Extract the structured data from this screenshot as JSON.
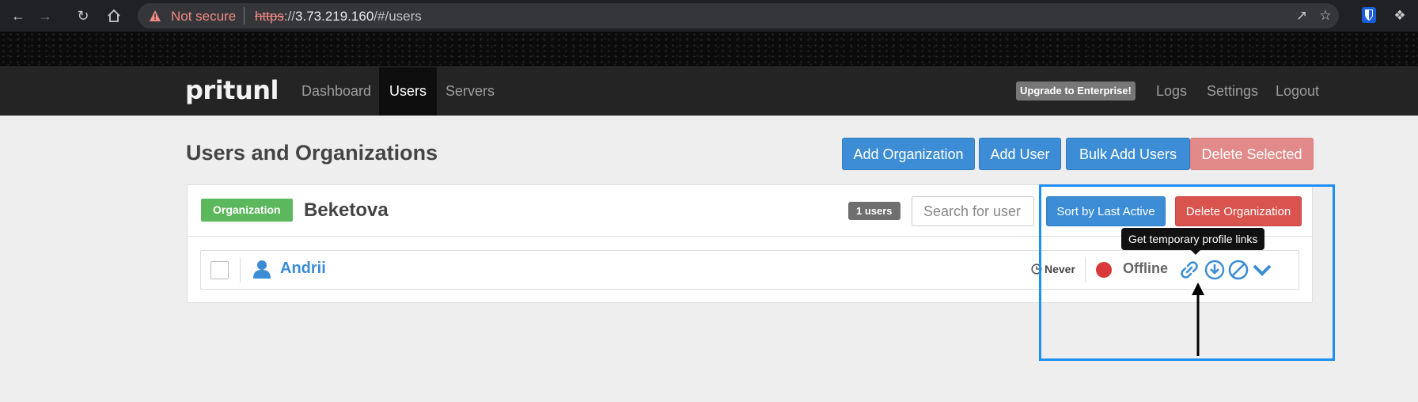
{
  "browser": {
    "not_secure": "Not secure",
    "url_proto": "https",
    "url_host": "3.73.219.160",
    "url_path": "/#/users"
  },
  "navbar": {
    "brand": "pritunl",
    "links": {
      "dashboard": "Dashboard",
      "users": "Users",
      "servers": "Servers",
      "logs": "Logs",
      "settings": "Settings",
      "logout": "Logout"
    },
    "upgrade": "Upgrade to Enterprise!"
  },
  "page": {
    "title": "Users and Organizations",
    "buttons": {
      "add_org": "Add Organization",
      "add_user": "Add User",
      "bulk_add": "Bulk Add Users",
      "delete_selected": "Delete Selected"
    }
  },
  "organization": {
    "label": "Organization",
    "name": "Beketova",
    "user_count": "1 users",
    "search_placeholder": "Search for user",
    "sort_button": "Sort by Last Active",
    "delete_button": "Delete Organization"
  },
  "user": {
    "name": "Andrii",
    "last_active": "Never",
    "status": "Offline"
  },
  "tooltip": "Get temporary profile links",
  "colors": {
    "accent": "#3c8dd5",
    "danger": "#d9534f",
    "success": "#5cb85c",
    "highlight": "#1e8ff5"
  }
}
